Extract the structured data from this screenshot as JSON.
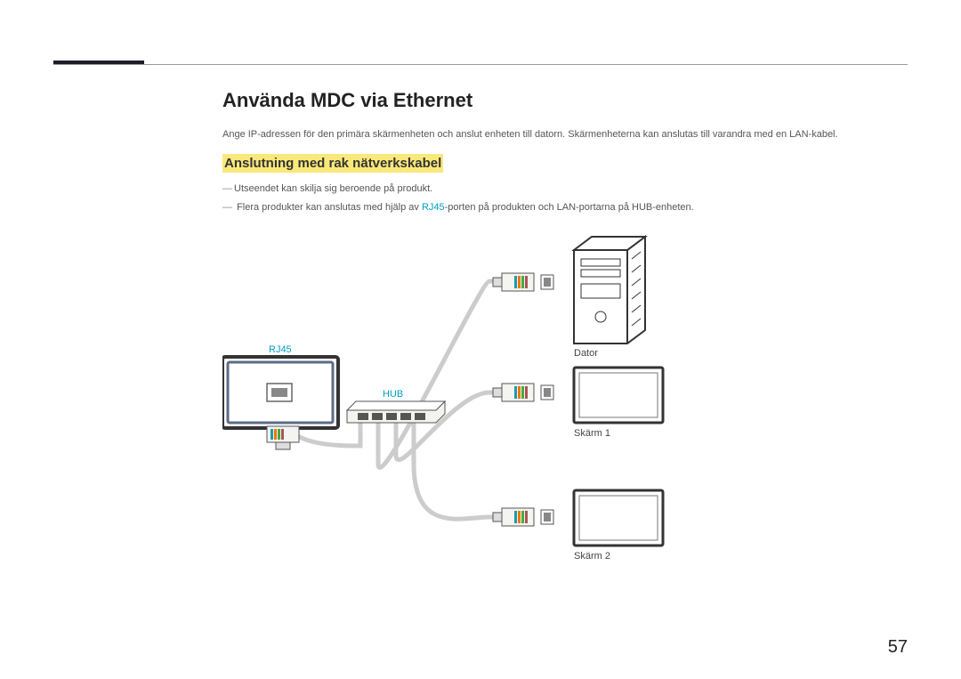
{
  "heading": "Använda MDC via Ethernet",
  "intro": "Ange IP-adressen för den primära skärmenheten och anslut enheten till datorn. Skärmenheterna kan anslutas till varandra med en LAN-kabel.",
  "subheading": "Anslutning med rak nätverkskabel",
  "notes": {
    "n1": "Utseendet kan skilja sig beroende på produkt.",
    "n2_pre": "Flera produkter kan anslutas med hjälp av ",
    "n2_port": "RJ45",
    "n2_post": "-porten på produkten och LAN-portarna på HUB-enheten."
  },
  "labels": {
    "rj45": "RJ45",
    "hub": "HUB",
    "dator": "Dator",
    "skarm1": "Skärm 1",
    "skarm2": "Skärm 2"
  },
  "page_number": "57"
}
